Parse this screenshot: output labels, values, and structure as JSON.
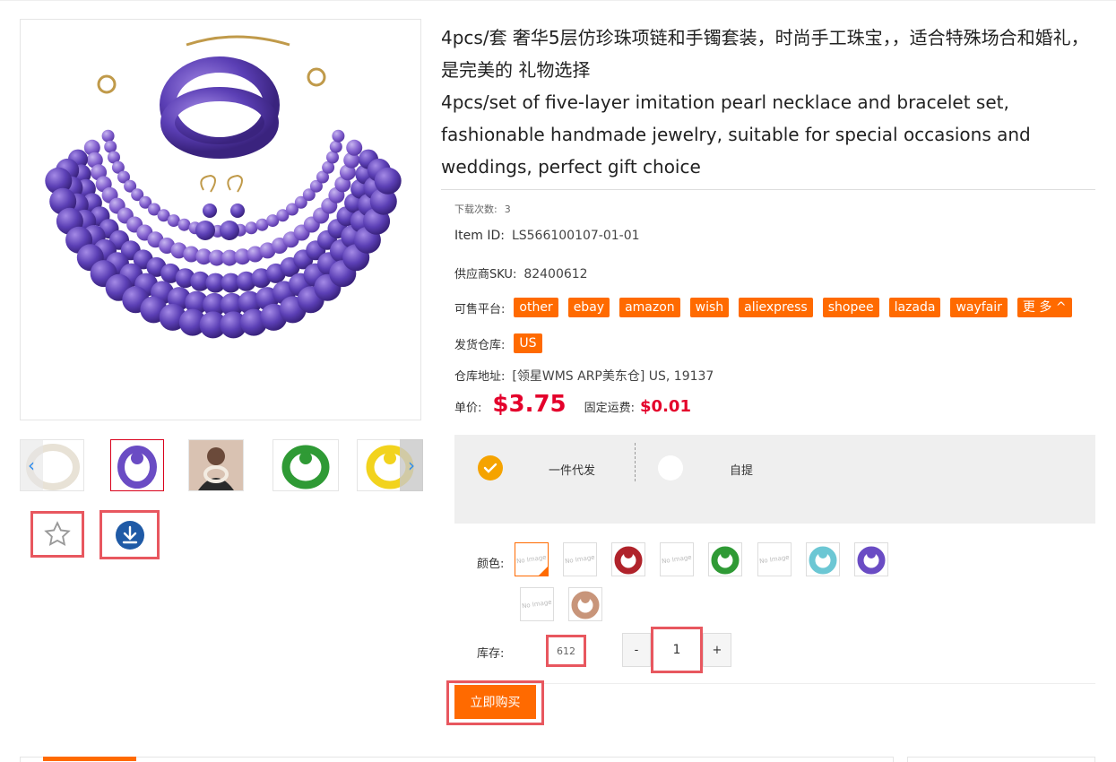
{
  "product": {
    "title_cn": "4pcs/套 奢华5层仿珍珠项链和手镯套装，时尚手工珠宝，，适合特殊场合和婚礼，是完美的 礼物选择",
    "title_en": "4pcs/set of five-layer imitation pearl necklace and bracelet set, fashionable handmade jewelry, suitable for special occasions and weddings, perfect gift choice"
  },
  "meta": {
    "downloads_label": "下载次数:",
    "downloads_value": "3",
    "item_id_label": "Item ID:",
    "item_id_value": "LS566100107-01-01",
    "supplier_sku_label": "供应商SKU:",
    "supplier_sku_value": "82400612",
    "platforms_label": "可售平台:",
    "platforms": [
      "other",
      "ebay",
      "amazon",
      "wish",
      "aliexpress",
      "shopee",
      "lazada",
      "wayfair"
    ],
    "more_label": "更 多 ^",
    "warehouse_label": "发货仓库:",
    "warehouse_value": "US",
    "address_label": "仓库地址:",
    "address_value": "[领星WMS ARP美东仓] US, 19137"
  },
  "price": {
    "unit_label": "单价:",
    "unit_value": "$3.75",
    "shipping_label": "固定运费:",
    "shipping_value": "$0.01"
  },
  "shipping_options": {
    "option1": "一件代发",
    "option2": "自提"
  },
  "colors": {
    "label": "颜色:",
    "swatches": [
      {
        "type": "noimage",
        "selected": true
      },
      {
        "type": "noimage",
        "selected": false
      },
      {
        "type": "red",
        "selected": false
      },
      {
        "type": "noimage",
        "selected": false
      },
      {
        "type": "green",
        "selected": false
      },
      {
        "type": "noimage",
        "selected": false
      },
      {
        "type": "cyan",
        "selected": false
      },
      {
        "type": "purple",
        "selected": false
      },
      {
        "type": "noimage",
        "selected": false
      },
      {
        "type": "bronze",
        "selected": false
      }
    ],
    "noimage_text": "No Image"
  },
  "stock": {
    "label": "库存:",
    "value": "612"
  },
  "quantity": {
    "minus": "-",
    "value": "1",
    "plus": "+"
  },
  "buy_now": "立即购买",
  "icons": {
    "favorite": "star-icon",
    "download": "download-icon",
    "prev": "chevron-left-icon",
    "next": "chevron-right-icon"
  },
  "colors_theme": {
    "accent": "#ff6a00",
    "price": "#e4002b",
    "highlight": "#e8575f",
    "download_bg": "#1f5aa6"
  }
}
